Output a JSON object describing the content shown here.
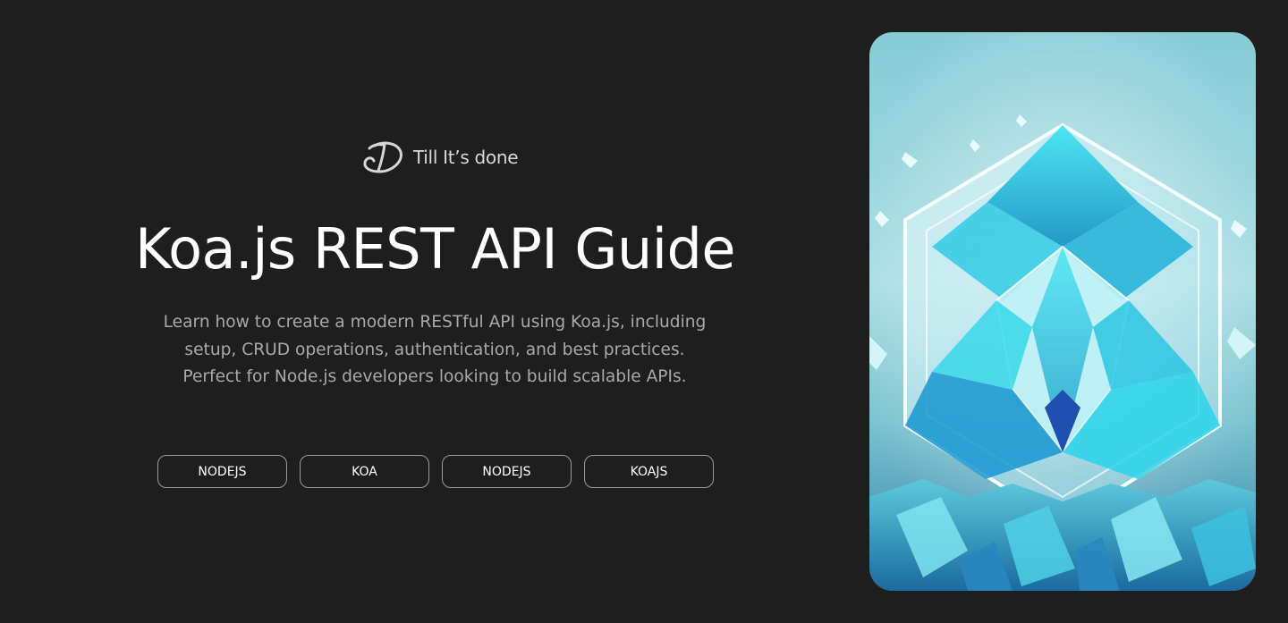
{
  "brand": {
    "name": "Till It’s done",
    "logo_icon": "script-d-logo-icon"
  },
  "hero": {
    "title": "Koa.js REST API Guide",
    "description_lines": [
      "Learn how to create a modern RESTful API using Koa.js, including",
      "setup, CRUD operations, authentication, and best practices.",
      "Perfect for Node.js developers looking to build scalable APIs."
    ]
  },
  "tags": [
    "NODEJS",
    "KOA",
    "NODEJS",
    "KOAJS"
  ],
  "image": {
    "subject": "crystal-hexagon-illustration",
    "colors": {
      "sky": "#9fd6df",
      "crystal": "#23d3e6",
      "deep": "#1f5fb0"
    }
  }
}
